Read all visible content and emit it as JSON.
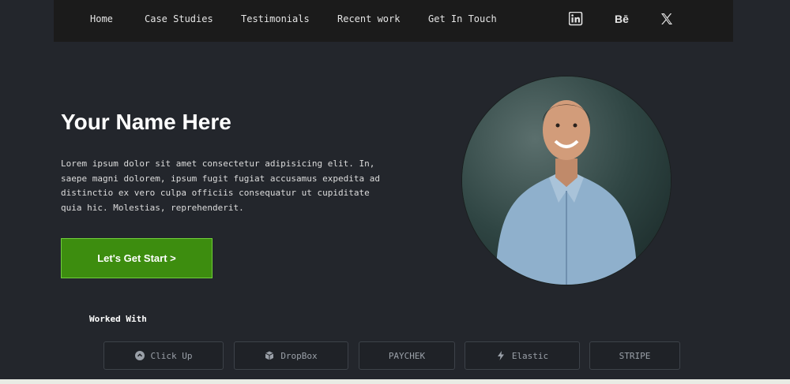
{
  "nav": {
    "links": [
      "Home",
      "Case Studies",
      "Testimonials",
      "Recent work",
      "Get In Touch"
    ],
    "social": {
      "linkedin_icon": "linkedin-icon",
      "behance_label": "Bē",
      "x_icon": "x-icon"
    }
  },
  "hero": {
    "title": "Your Name Here",
    "description": "Lorem ipsum dolor sit amet consectetur adipisicing elit. In, saepe magni dolorem, ipsum fugit fugiat accusamus expedita ad distinctio ex vero culpa officiis consequatur ut cupiditate quia hic. Molestias, reprehenderit.",
    "cta_label": "Let's Get Start >",
    "portrait_icon": "profile-photo"
  },
  "worked_with": {
    "title": "Worked With",
    "brands": [
      {
        "label": "Click Up",
        "icon": "clickup-icon"
      },
      {
        "label": "DropBox",
        "icon": "dropbox-icon"
      },
      {
        "label": "PAYCHEK",
        "icon": ""
      },
      {
        "label": "Elastic",
        "icon": "bolt-icon"
      },
      {
        "label": "STRIPE",
        "icon": ""
      }
    ]
  },
  "colors": {
    "background": "#23262c",
    "navbar": "#1b1b1b",
    "cta": "#3d8d0f",
    "cta_border": "#6fcf3a"
  }
}
